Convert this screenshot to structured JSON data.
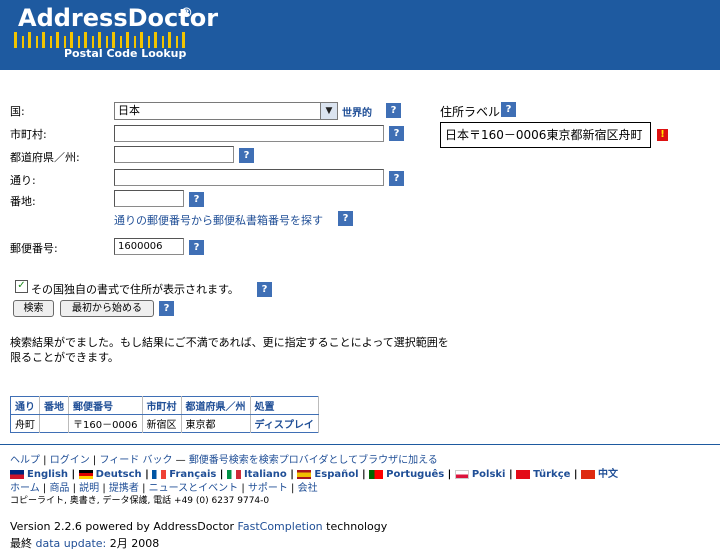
{
  "header": {
    "logo": "AddressDoctor",
    "registered": "®",
    "subtitle": "Postal Code Lookup"
  },
  "form": {
    "country_label": "国:",
    "country_value": "日本",
    "country_link": "世界的",
    "city_label": "市町村:",
    "city_value": "",
    "prefecture_label": "都道府県／州:",
    "prefecture_value": "",
    "street_label": "通り:",
    "street_value": "",
    "house_label": "番地:",
    "house_value": "",
    "pobox_link": "通りの郵便番号から郵便私書箱番号を探す",
    "postal_label": "郵便番号:",
    "postal_value": "1600006",
    "native_format_label": "その国独自の書式で住所が表示されます。",
    "native_format_checked": true,
    "search_button": "検索",
    "restart_button": "最初から始める",
    "help_glyph": "?"
  },
  "address_label": {
    "title": "住所ラベル",
    "value": "日本〒160－0006東京都新宿区舟町",
    "warning_glyph": "!"
  },
  "result_message_line1": "検索結果がでました。もし結果にご不満であれば、更に指定することによって選択範囲を",
  "result_message_line2": "限ることができます。",
  "results": {
    "headers": [
      "通り",
      "番地",
      "郵便番号",
      "市町村",
      "都道府県／州",
      "処置"
    ],
    "row": [
      "舟町",
      "",
      "〒160－0006",
      "新宿区",
      "東京都",
      "ディスプレイ"
    ]
  },
  "footer": {
    "help": "ヘルプ",
    "login": "ログイン",
    "feedback": "フィード バック",
    "provider_link": "郵便番号検索を検索プロバイダとしてブラウザに加える",
    "languages": [
      "English",
      "Deutsch",
      "Français",
      "Italiano",
      "Español",
      "Português",
      "Polski",
      "Türkçe",
      "中文"
    ],
    "home": "ホーム",
    "products": "商品",
    "description": "説明",
    "partners": "提携者",
    "news": "ニュースとイベント",
    "support": "サポート",
    "company": "会社",
    "copyright": "コピーライト, 奥書き, データ保護, 電話 +49 (0) 6237 9774-0",
    "version_prefix": "Version 2.2.6 powered by AddressDoctor",
    "fastcompletion": "FastCompletion",
    "version_suffix": "technology",
    "last_label": "最終",
    "data_update_label": "data update:",
    "data_update_value": "2月 2008"
  }
}
